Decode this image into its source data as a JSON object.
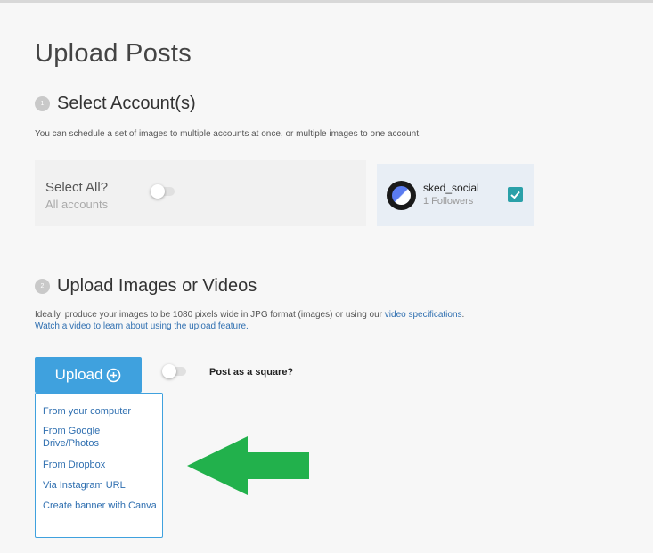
{
  "page": {
    "title": "Upload Posts"
  },
  "steps": {
    "select": {
      "number": "1",
      "title": "Select Account(s)",
      "description": "You can schedule a set of images to multiple accounts at once, or multiple images to one account."
    },
    "upload": {
      "number": "2",
      "title": "Upload Images or Videos",
      "description_prefix": "Ideally, produce your images to be 1080 pixels wide in JPG format (images) or using our ",
      "description_link": "video specifications",
      "description_suffix": ".",
      "video_link": "Watch a video to learn about using the upload feature."
    }
  },
  "select_all": {
    "label": "Select All?",
    "sublabel": "All accounts",
    "toggle_on": false
  },
  "account": {
    "name": "sked_social",
    "followers": "1 Followers",
    "checked": true
  },
  "upload": {
    "button_label": "Upload",
    "square_label": "Post as a square?",
    "square_toggle_on": false,
    "menu": [
      "From your computer",
      "From Google Drive/Photos",
      "From Dropbox",
      "Via Instagram URL",
      "Create banner with Canva"
    ]
  },
  "colors": {
    "accent": "#3fa1de",
    "link": "#2f6fb0",
    "check": "#2aa0a8",
    "arrow": "#22b14c",
    "account_bg": "#e8eef5"
  },
  "icons": {
    "upload_icon": "circle-plus-icon",
    "check_icon": "checkmark-icon",
    "arrow": "left-arrow-icon"
  }
}
